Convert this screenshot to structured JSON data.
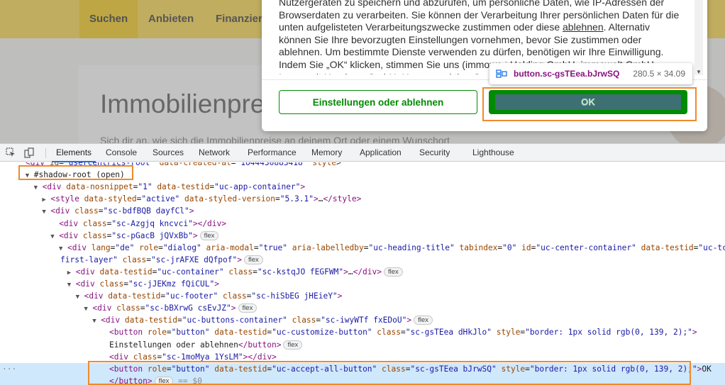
{
  "site": {
    "nav_tabs": [
      "Suchen",
      "Anbieten",
      "Finanziere"
    ],
    "hero_title": "Immobilienprei",
    "hero_sub": "Sich dir an, wie sich die Immobilienpreise an deinem Ort oder einem Wunschort"
  },
  "consent": {
    "text_before_link": "Nutzergeräten zu speichern und abzurufen, um persönliche Daten, wie IP-Adressen der Browserdaten zu verarbeiten. Sie können der Verarbeitung Ihrer persönlichen Daten für die unten aufgelisteten Verarbeitungszwecke zustimmen oder diese ",
    "link_text": "ablehnen",
    "text_after_link": ". Alternativ können Sie Ihre bevorzugten Einstellungen vornehmen, bevor Sie zustimmen oder ablehnen. Um bestimmte Dienste verwenden zu dürfen, benötigen wir Ihre Einwilligung. Indem Sie „OK“ klicken, stimmen Sie uns (immowelt Holding GmbH, immowelt GmbH, Immowelt Hamburg GmbH, Umzugsauktion GmbH ...",
    "settings_button": "Einstellungen oder ablehnen",
    "ok_button": "OK"
  },
  "tooltip": {
    "selector": "button.sc-gsTEea.bJrwSQ",
    "dimensions": "280.5 × 34.09"
  },
  "devtools": {
    "tabs": [
      "Elements",
      "Console",
      "Sources",
      "Network",
      "Performance",
      "Memory",
      "Application",
      "Security",
      "Lighthouse"
    ],
    "active_tab": "Elements",
    "rows": [
      {
        "indent": 0,
        "html": "<span class='tag'>&lt;div</span> <span class='an'>id</span>=<span class='av'>\"usercentrics-root\"</span> <span class='an'>data-created-at</span>=<span class='av'>\"1644430883418\"</span> <span class='an'>style</span>&gt;"
      },
      {
        "indent": 1,
        "tw": "▼",
        "html": "#shadow-root (open)"
      },
      {
        "indent": 2,
        "tw": "▼",
        "html": "<span class='tag'>&lt;div</span> <span class='an'>data-nosnippet</span>=<span class='av'>\"1\"</span> <span class='an'>data-testid</span>=<span class='av'>\"uc-app-container\"</span><span class='tag'>&gt;</span>"
      },
      {
        "indent": 3,
        "tw": "▶",
        "html": "<span class='tag'>&lt;style</span> <span class='an'>data-styled</span>=<span class='av'>\"active\"</span> <span class='an'>data-styled-version</span>=<span class='av'>\"5.3.1\"</span><span class='tag'>&gt;</span>…<span class='tag'>&lt;/style&gt;</span>"
      },
      {
        "indent": 3,
        "tw": "▼",
        "html": "<span class='tag'>&lt;div</span> <span class='an'>class</span>=<span class='av'>\"sc-bdfBQB dayfCl\"</span><span class='tag'>&gt;</span>"
      },
      {
        "indent": 4,
        "html": "<span class='tag'>&lt;div</span> <span class='an'>class</span>=<span class='av'>\"sc-Azgjq kncvci\"</span><span class='tag'>&gt;&lt;/div&gt;</span>"
      },
      {
        "indent": 4,
        "tw": "▼",
        "html": "<span class='tag'>&lt;div</span> <span class='an'>class</span>=<span class='av'>\"sc-pGacB jQVxBb\"</span><span class='tag'>&gt;</span>",
        "chip": "flex"
      },
      {
        "indent": 5,
        "tw": "▼",
        "html": "<span class='tag'>&lt;div</span> <span class='an'>lang</span>=<span class='av'>\"de\"</span> <span class='an'>role</span>=<span class='av'>\"dialog\"</span> <span class='an'>aria-modal</span>=<span class='av'>\"true\"</span> <span class='an'>aria-labelledby</span>=<span class='av'>\"uc-heading-title\"</span> <span class='an'>tabindex</span>=<span class='av'>\"0\"</span> <span class='an'>id</span>=<span class='av'>\"uc-center-container\"</span> <span class='an'>data-testid</span>=<span class='av'>\"uc-tcf-</span>"
      },
      {
        "indent": 5,
        "html": "<span class='av'>first-layer\"</span> <span class='an'>class</span>=<span class='av'>\"sc-jrAFXE dQfpof\"</span><span class='tag'>&gt;</span>",
        "chip": "flex",
        "noindent_tw": true
      },
      {
        "indent": 6,
        "tw": "▶",
        "html": "<span class='tag'>&lt;div</span> <span class='an'>data-testid</span>=<span class='av'>\"uc-container\"</span> <span class='an'>class</span>=<span class='av'>\"sc-kstqJO fEGFWM\"</span><span class='tag'>&gt;</span>…<span class='tag'>&lt;/div&gt;</span>",
        "chip": "flex"
      },
      {
        "indent": 6,
        "tw": "▼",
        "html": "<span class='tag'>&lt;div</span> <span class='an'>class</span>=<span class='av'>\"sc-jJEKmz fQiCUL\"</span><span class='tag'>&gt;</span>"
      },
      {
        "indent": 7,
        "tw": "▼",
        "html": "<span class='tag'>&lt;div</span> <span class='an'>data-testid</span>=<span class='av'>\"uc-footer\"</span> <span class='an'>class</span>=<span class='av'>\"sc-hiSbEG jHEieY\"</span><span class='tag'>&gt;</span>"
      },
      {
        "indent": 8,
        "tw": "▼",
        "html": "<span class='tag'>&lt;div</span> <span class='an'>class</span>=<span class='av'>\"sc-bBXrwG csEvJZ\"</span><span class='tag'>&gt;</span>",
        "chip": "flex"
      },
      {
        "indent": 9,
        "tw": "▼",
        "html": "<span class='tag'>&lt;div</span> <span class='an'>data-testid</span>=<span class='av'>\"uc-buttons-container\"</span> <span class='an'>class</span>=<span class='av'>\"sc-iwyWTf fxEDoU\"</span><span class='tag'>&gt;</span>",
        "chip": "flex"
      },
      {
        "indent": 10,
        "html": "<span class='tag'>&lt;button</span> <span class='an'>role</span>=<span class='av'>\"button\"</span> <span class='an'>data-testid</span>=<span class='av'>\"uc-customize-button\"</span> <span class='an'>class</span>=<span class='av'>\"sc-gsTEea dHkJlo\"</span> <span class='an'>style</span>=<span class='av'>\"border: 1px solid rgb(0, 139, 2);\"</span><span class='tag'>&gt;</span>"
      },
      {
        "indent": 10,
        "html": "<span class='txt'>Einstellungen oder ablehnen</span><span class='tag'>&lt;/button&gt;</span>",
        "chip": "flex"
      },
      {
        "indent": 10,
        "html": "<span class='tag'>&lt;div</span> <span class='an'>class</span>=<span class='av'>\"sc-1moMya 1YsLM\"</span><span class='tag'>&gt;&lt;/div&gt;</span>"
      },
      {
        "indent": 10,
        "html": "<span class='tag'>&lt;button</span> <span class='an'>role</span>=<span class='av'>\"button\"</span> <span class='an'>data-testid</span>=<span class='av'>\"uc-accept-all-button\"</span> <span class='an'>class</span>=<span class='av'>\"sc-gsTEea bJrwSQ\"</span> <span class='an'>style</span>=<span class='av'>\"border: 1px solid rgb(0, 139, 2);\"</span><span class='tag'>&gt;</span><span class='txt'>OK</span>",
        "selected": true
      },
      {
        "indent": 10,
        "html": "<span class='tag'>&lt;/button&gt;</span>",
        "chip": "flex",
        "suffix": " == $0",
        "selected": true
      }
    ]
  },
  "colors": {
    "brand_yellow": "#fbd94c",
    "ok_green": "#008b02",
    "annotation_orange": "#f08a2b"
  }
}
